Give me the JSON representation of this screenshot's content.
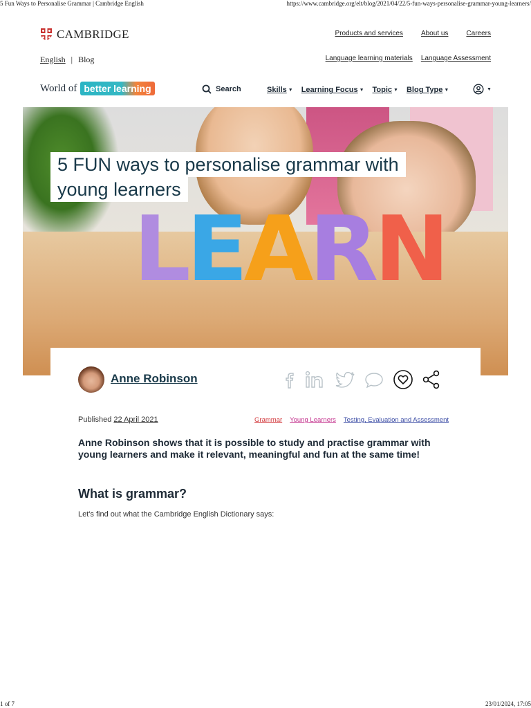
{
  "print": {
    "header_left": "5 Fun Ways to Personalise Grammar | Cambridge English",
    "header_right": "https://www.cambridge.org/elt/blog/2021/04/22/5-fun-ways-personalise-grammar-young-learners/",
    "footer_left": "1 of 7",
    "footer_right": "23/01/2024, 17:05"
  },
  "brand": {
    "name": "CAMBRIDGE"
  },
  "top_links": [
    "Products and services",
    "About us",
    "Careers"
  ],
  "lang": {
    "current": "English",
    "separator": "|",
    "blog": "Blog"
  },
  "secondary_links": [
    "Language learning materials",
    "Language Assessment"
  ],
  "wobl": {
    "prefix": "World of",
    "pill": "better learning"
  },
  "search": {
    "label": "Search"
  },
  "nav": [
    "Skills",
    "Learning Focus",
    "Topic",
    "Blog Type"
  ],
  "hero": {
    "title_line1": "5 FUN ways to personalise grammar with",
    "title_line2": "young learners",
    "letters": [
      "L",
      "E",
      "A",
      "R",
      "N"
    ]
  },
  "author": {
    "name": "Anne Robinson"
  },
  "social_icons": [
    "facebook-icon",
    "linkedin-icon",
    "twitter-icon",
    "comment-icon",
    "like-icon",
    "share-icon"
  ],
  "meta": {
    "published_label": "Published",
    "date": "22 April 2021",
    "tags": [
      "Grammar",
      "Young Learners",
      "Testing, Evaluation and Assessment"
    ]
  },
  "article": {
    "lede": "Anne Robinson shows that it is possible to study and practise grammar with young learners and make it relevant, meaningful and fun at the same time!",
    "heading": "What is grammar?",
    "paragraph": "Let's find out what the Cambridge English Dictionary says:"
  },
  "colors": {
    "title": "#1a3a4a",
    "pill_teal": "#2bb5c4",
    "pill_orange": "#ee6a3a",
    "tag_grammar": "#d2363a",
    "tag_young": "#c4338e",
    "tag_testing": "#3d4ea6"
  }
}
